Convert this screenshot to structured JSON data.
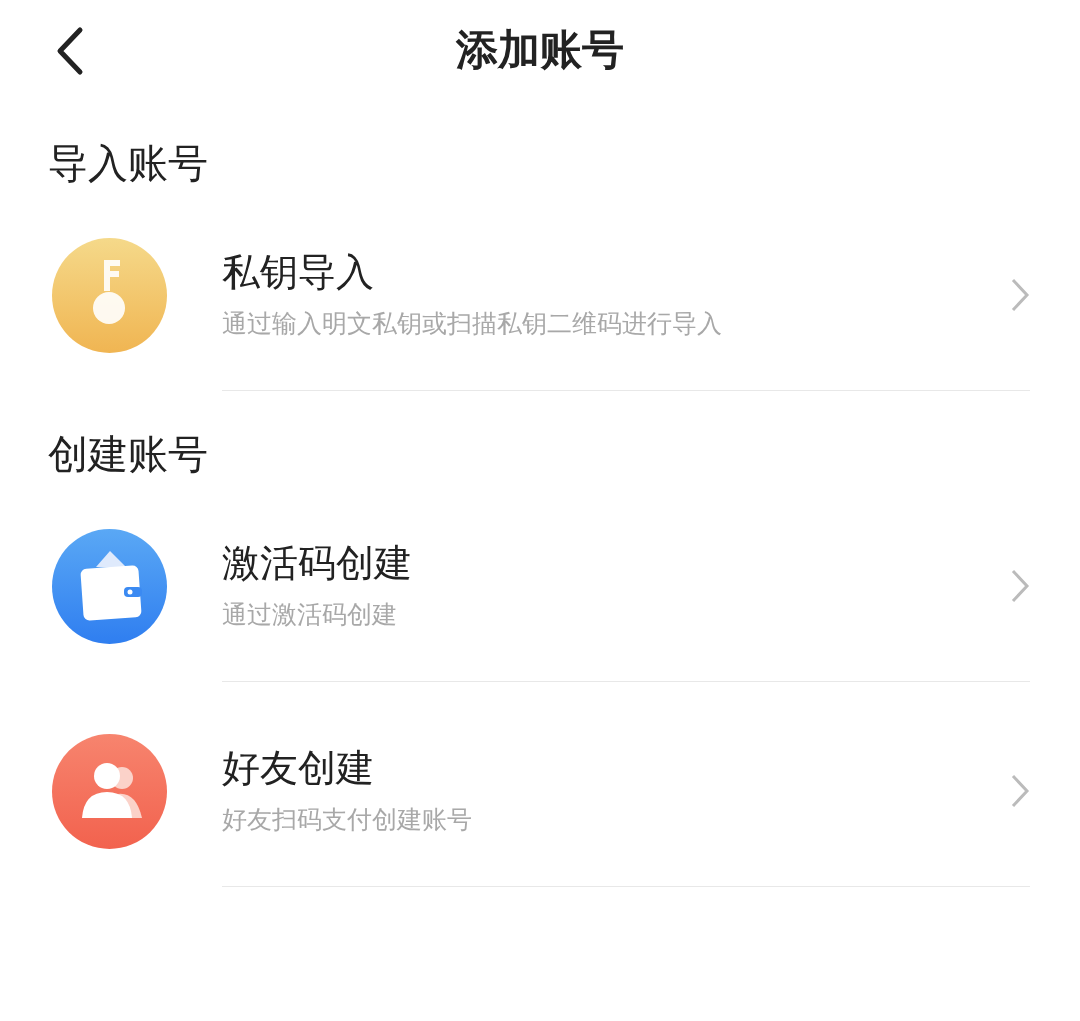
{
  "header": {
    "title": "添加账号"
  },
  "sections": [
    {
      "title": "导入账号",
      "items": [
        {
          "kind": "key",
          "title": "私钥导入",
          "subtitle": "通过输入明文私钥或扫描私钥二维码进行导入"
        }
      ]
    },
    {
      "title": "创建账号",
      "items": [
        {
          "kind": "wallet",
          "title": "激活码创建",
          "subtitle": "通过激活码创建"
        },
        {
          "kind": "people",
          "title": "好友创建",
          "subtitle": "好友扫码支付创建账号"
        }
      ]
    }
  ]
}
